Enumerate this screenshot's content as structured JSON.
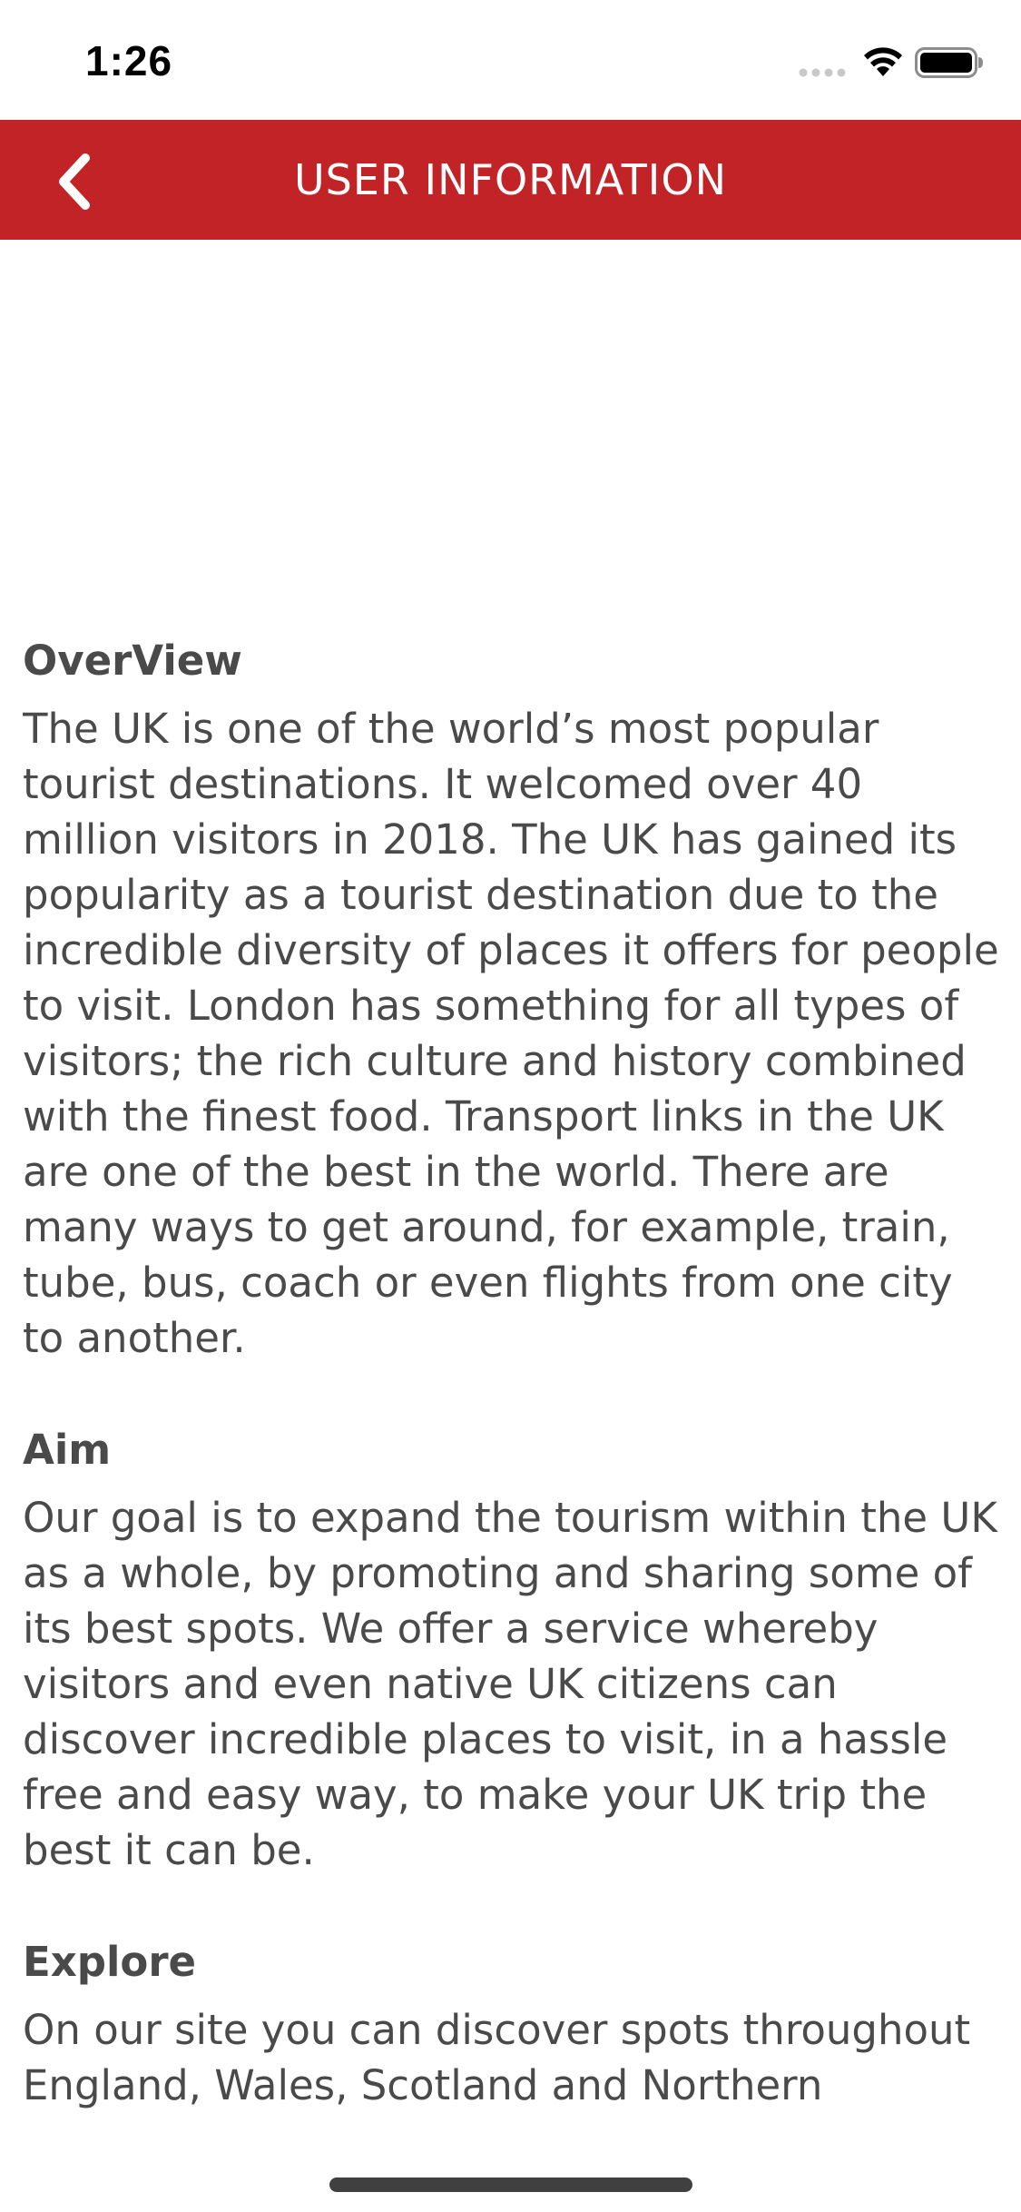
{
  "status_bar": {
    "time": "1:26",
    "icons": [
      "cellular-signal-icon",
      "wifi-icon",
      "battery-icon"
    ]
  },
  "header": {
    "title": "USER INFORMATION",
    "back_icon": "chevron-left-icon",
    "background_color": "#c12326",
    "text_color": "#ffffff"
  },
  "sections": [
    {
      "heading": "OverView",
      "body": "The UK is one of the world’s most popular tourist destinations. It welcomed over 40 million visitors in 2018. The UK has gained its popularity as a tourist destination due to the incredible diversity of places it offers for people to visit. London has something for all types of visitors; the rich culture and history combined with the finest food. Transport links in the UK are one of the best in the world. There are many ways to get around, for example, train, tube, bus, coach or even flights from one city to another."
    },
    {
      "heading": "Aim",
      "body": "Our goal is to expand the tourism within the UK as a whole, by promoting and sharing some of its best spots. We offer a service whereby visitors and even native UK citizens can discover incredible places to visit, in a hassle free and easy way, to make your UK trip the best it can be."
    },
    {
      "heading": "Explore",
      "body": "On our site you can discover spots throughout England, Wales, Scotland and Northern"
    }
  ],
  "colors": {
    "text": "#4a4a4a",
    "accent": "#c12326"
  }
}
